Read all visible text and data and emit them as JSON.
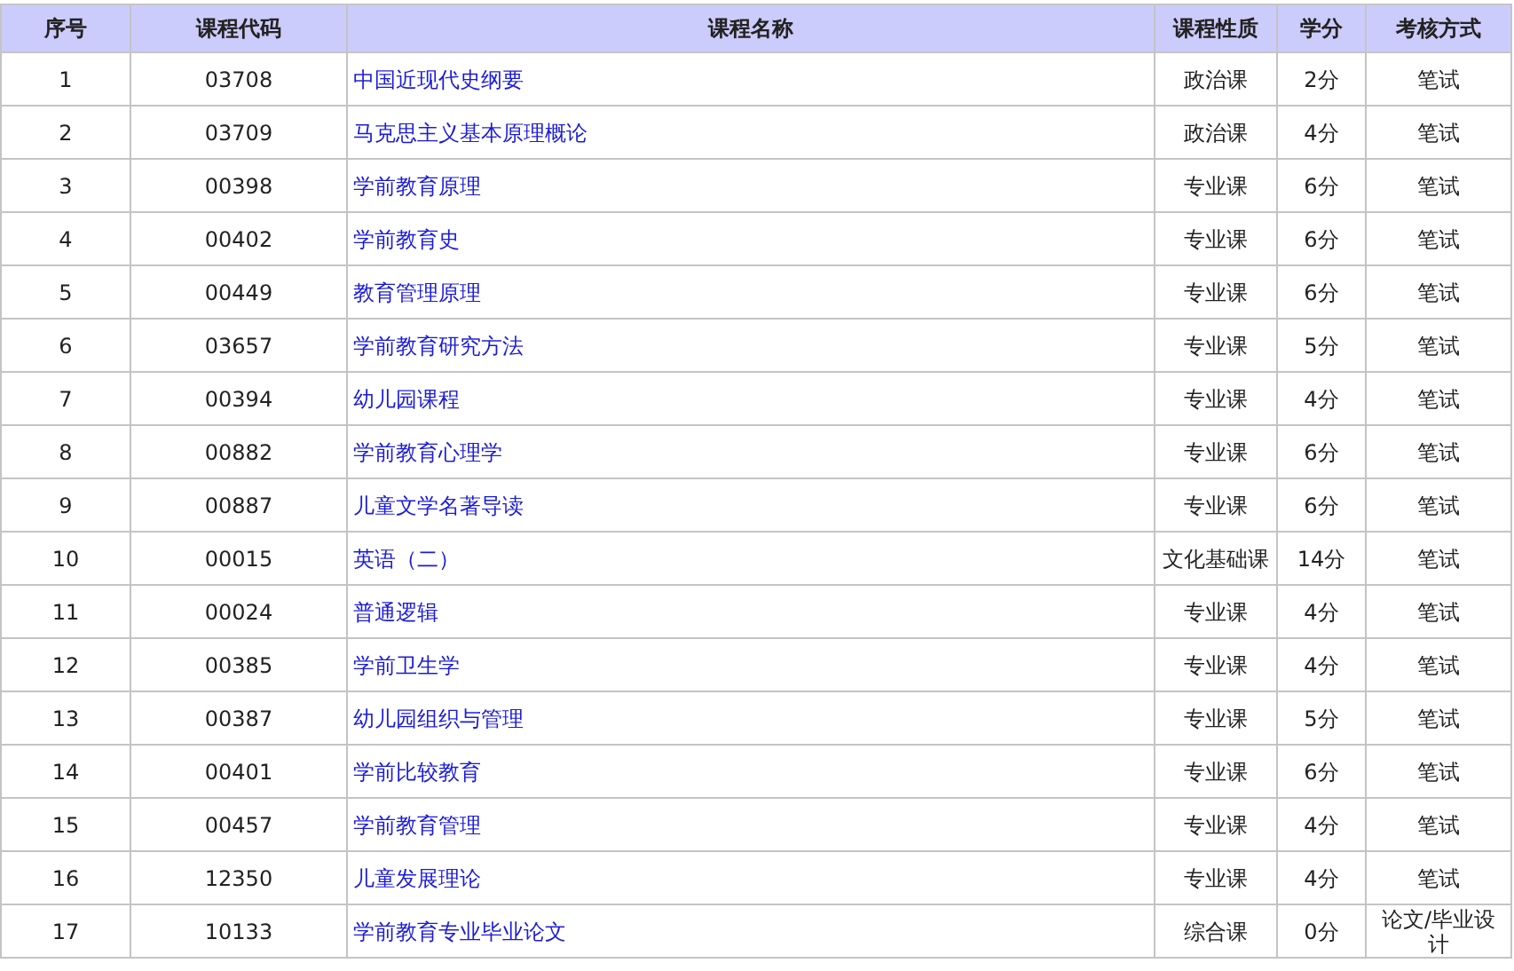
{
  "table": {
    "columns": [
      "序号",
      "课程代码",
      "课程名称",
      "课程性质",
      "学分",
      "考核方式"
    ],
    "rows": [
      [
        "1",
        "03708",
        "中国近现代史纲要",
        "政治课",
        "2分",
        "笔试"
      ],
      [
        "2",
        "03709",
        "马克思主义基本原理概论",
        "政治课",
        "4分",
        "笔试"
      ],
      [
        "3",
        "00398",
        "学前教育原理",
        "专业课",
        "6分",
        "笔试"
      ],
      [
        "4",
        "00402",
        "学前教育史",
        "专业课",
        "6分",
        "笔试"
      ],
      [
        "5",
        "00449",
        "教育管理原理",
        "专业课",
        "6分",
        "笔试"
      ],
      [
        "6",
        "03657",
        "学前教育研究方法",
        "专业课",
        "5分",
        "笔试"
      ],
      [
        "7",
        "00394",
        "幼儿园课程",
        "专业课",
        "4分",
        "笔试"
      ],
      [
        "8",
        "00882",
        "学前教育心理学",
        "专业课",
        "6分",
        "笔试"
      ],
      [
        "9",
        "00887",
        "儿童文学名著导读",
        "专业课",
        "6分",
        "笔试"
      ],
      [
        "10",
        "00015",
        "英语（二）",
        "文化基础课",
        "14分",
        "笔试"
      ],
      [
        "11",
        "00024",
        "普通逻辑",
        "专业课",
        "4分",
        "笔试"
      ],
      [
        "12",
        "00385",
        "学前卫生学",
        "专业课",
        "4分",
        "笔试"
      ],
      [
        "13",
        "00387",
        "幼儿园组织与管理",
        "专业课",
        "5分",
        "笔试"
      ],
      [
        "14",
        "00401",
        "学前比较教育",
        "专业课",
        "6分",
        "笔试"
      ],
      [
        "15",
        "00457",
        "学前教育管理",
        "专业课",
        "4分",
        "笔试"
      ],
      [
        "16",
        "12350",
        "儿童发展理论",
        "专业课",
        "4分",
        "笔试"
      ],
      [
        "17",
        "10133",
        "学前教育专业毕业论文",
        "综合课",
        "0分",
        "论文/毕业设计"
      ]
    ]
  }
}
